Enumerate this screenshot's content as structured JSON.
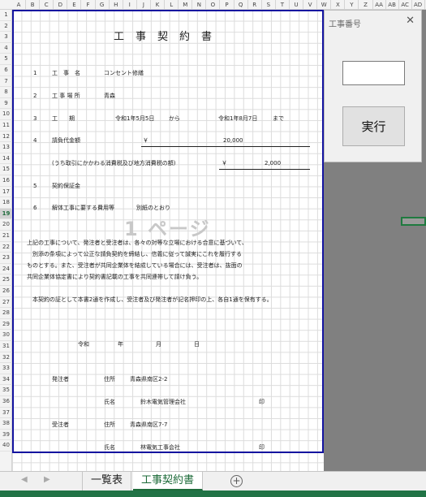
{
  "columns": [
    "A",
    "B",
    "C",
    "D",
    "E",
    "F",
    "G",
    "H",
    "I",
    "J",
    "K",
    "L",
    "M",
    "N",
    "O",
    "P",
    "Q",
    "R",
    "S",
    "T",
    "U",
    "V",
    "W",
    "X",
    "Y",
    "Z",
    "AA",
    "AB",
    "AC",
    "AD"
  ],
  "rows": [
    "1",
    "2",
    "3",
    "4",
    "5",
    "6",
    "7",
    "8",
    "9",
    "10",
    "11",
    "12",
    "13",
    "14",
    "15",
    "16",
    "17",
    "18",
    "19",
    "20",
    "21",
    "22",
    "23",
    "24",
    "25",
    "26",
    "27",
    "28",
    "29",
    "30",
    "31",
    "32",
    "33",
    "34",
    "35",
    "36",
    "37",
    "38",
    "39",
    "40"
  ],
  "selected_row": "19",
  "document": {
    "title": "工事契約書",
    "item1_no": "1",
    "item1_label": "工　事　名",
    "item1_value": "コンセント修繕",
    "item2_no": "2",
    "item2_label": "工 事 場 所",
    "item2_value": "青森",
    "item3_no": "3",
    "item3_label": "工　　期",
    "item3_from": "令和1年5月5日",
    "item3_from_suffix": "から",
    "item3_to": "令和1年8月7日",
    "item3_to_suffix": "まで",
    "item4_no": "4",
    "item4_label": "請負代金額",
    "item4_yen": "￥",
    "item4_value": "20,000",
    "tax_label": "(うち取引にかかわる消費税及び地方消費税の額)",
    "tax_yen": "￥",
    "tax_value": "2,000",
    "item5_no": "5",
    "item5_label": "契約保証金",
    "item6_no": "6",
    "item6_label": "解体工事に要する費用等",
    "item6_value": "別紙のとおり",
    "watermark": "1 ページ",
    "para1_line1": "上記の工事について、発注者と受注者は、各々の対等な立場における合意に基づいて、",
    "para1_line2": "　別添の条項によって公正な請負契約を締結し、信義に従って誠実にこれを履行する",
    "para1_line3": "ものとする。また、受注者が共同企業体を結成している場合には、受注者は、抜面の",
    "para1_line4": "共同企業体協定書により契約書記載の工事を共同連帯して請け負う。",
    "para2": "本契約の証として本書2通を作成し、受注者及び発注者が記名押印の上、各自1通を保有する。",
    "date_era": "令和",
    "date_year": "年",
    "date_month": "月",
    "date_day": "日",
    "orderer_label": "発注者",
    "orderer_addr_label": "住所",
    "orderer_addr": "青森県南区2-2",
    "orderer_name_label": "氏名",
    "orderer_name": "鈴木電気管理会社",
    "orderer_seal": "印",
    "contractor_label": "受注者",
    "contractor_addr_label": "住所",
    "contractor_addr": "青森県南区7-7",
    "contractor_name_label": "氏名",
    "contractor_name": "林電気工事会社",
    "contractor_seal": "印"
  },
  "dialog": {
    "title": "工事番号",
    "close": "✕",
    "input_value": "",
    "run_button": "実行"
  },
  "tabs": [
    {
      "label": "一覧表",
      "active": false
    },
    {
      "label": "工事契約書",
      "active": true
    }
  ],
  "nav": {
    "prev": "◀",
    "next": "▶",
    "add": "+"
  }
}
